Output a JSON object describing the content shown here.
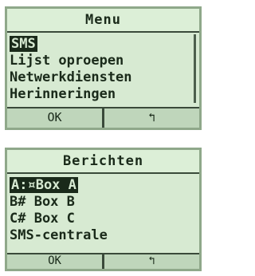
{
  "screen1": {
    "title": "Menu",
    "items": [
      "SMS",
      "Lijst oproepen",
      "Netwerkdiensten",
      "Herinneringen"
    ],
    "softkeys": {
      "left": "OK",
      "right": "↰"
    }
  },
  "screen2": {
    "title": "Berichten",
    "items": [
      "A:¤Box A",
      "B# Box B",
      "C# Box C",
      "SMS-centrale"
    ],
    "softkeys": {
      "left": "OK",
      "right": "↰"
    }
  }
}
